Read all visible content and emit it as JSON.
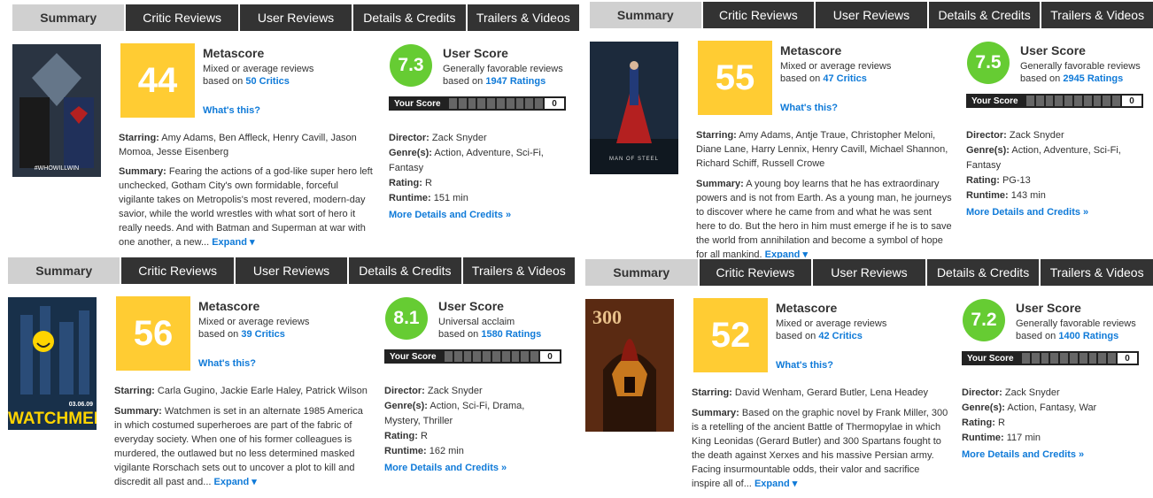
{
  "panels": [
    {
      "tabs": [
        "Summary",
        "Critic Reviews",
        "User Reviews",
        "Details & Credits",
        "Trailers & Videos"
      ],
      "metascore": "44",
      "metascore_title": "Metascore",
      "metascore_desc": "Mixed or average reviews",
      "based_on": "based on",
      "critics_link": "50 Critics",
      "whats_this": "What's this?",
      "userscore": "7.3",
      "userscore_title": "User Score",
      "userscore_desc": "Generally favorable reviews",
      "ratings_link": "1947 Ratings",
      "your_score_label": "Your Score",
      "your_score_value": "0",
      "starring_label": "Starring:",
      "starring": "Amy Adams, Ben Affleck, Henry Cavill, Jason Momoa, Jesse Eisenberg",
      "summary_label": "Summary:",
      "summary": "Fearing the actions of a god-like super hero left unchecked, Gotham City's own formidable, forceful vigilante takes on Metropolis's most revered, modern-day savior, while the world wrestles with what sort of hero it really needs. And with Batman and Superman at war with one another, a new...",
      "expand": "Expand ▾",
      "director_label": "Director:",
      "director": "Zack Snyder",
      "genres_label": "Genre(s):",
      "genres": "Action, Adventure, Sci-Fi, Fantasy",
      "rating_label": "Rating:",
      "rating": "R",
      "runtime_label": "Runtime:",
      "runtime": "151 min",
      "more_details": "More Details and Credits »",
      "poster_text": "#WHOWILLWIN",
      "colors": {
        "bg": "#2a3442",
        "accent": "#7f93a8"
      }
    },
    {
      "tabs": [
        "Summary",
        "Critic Reviews",
        "User Reviews",
        "Details & Credits",
        "Trailers & Videos"
      ],
      "metascore": "55",
      "metascore_title": "Metascore",
      "metascore_desc": "Mixed or average reviews",
      "based_on": "based on",
      "critics_link": "47 Critics",
      "whats_this": "What's this?",
      "userscore": "7.5",
      "userscore_title": "User Score",
      "userscore_desc": "Generally favorable reviews",
      "ratings_link": "2945 Ratings",
      "your_score_label": "Your Score",
      "your_score_value": "0",
      "starring_label": "Starring:",
      "starring": "Amy Adams, Antje Traue, Christopher Meloni, Diane Lane, Harry Lennix, Henry Cavill, Michael Shannon, Richard Schiff, Russell Crowe",
      "summary_label": "Summary:",
      "summary": "A young boy learns that he has extraordinary powers and is not from Earth. As a young man, he journeys to discover where he came from and what he was sent here to do. But the hero in him must emerge if he is to save the world from annihilation and become a symbol of hope for all mankind.",
      "expand": "Expand ▾",
      "director_label": "Director:",
      "director": "Zack Snyder",
      "genres_label": "Genre(s):",
      "genres": "Action, Adventure, Sci-Fi, Fantasy",
      "rating_label": "Rating:",
      "rating": "PG-13",
      "runtime_label": "Runtime:",
      "runtime": "143 min",
      "more_details": "More Details and Credits »",
      "poster_text": "MAN OF STEEL",
      "colors": {
        "bg": "#1c2a3c",
        "accent": "#b42020"
      }
    },
    {
      "tabs": [
        "Summary",
        "Critic Reviews",
        "User Reviews",
        "Details & Credits",
        "Trailers & Videos"
      ],
      "metascore": "56",
      "metascore_title": "Metascore",
      "metascore_desc": "Mixed or average reviews",
      "based_on": "based on",
      "critics_link": "39 Critics",
      "whats_this": "What's this?",
      "userscore": "8.1",
      "userscore_title": "User Score",
      "userscore_desc": "Universal acclaim",
      "ratings_link": "1580 Ratings",
      "your_score_label": "Your Score",
      "your_score_value": "0",
      "starring_label": "Starring:",
      "starring": "Carla Gugino, Jackie Earle Haley, Patrick Wilson",
      "summary_label": "Summary:",
      "summary": "Watchmen is set in an alternate 1985 America in which costumed superheroes are part of the fabric of everyday society. When one of his former colleagues is murdered, the outlawed but no less determined masked vigilante Rorschach sets out to uncover a plot to kill and discredit all past and...",
      "expand": "Expand ▾",
      "director_label": "Director:",
      "director": "Zack Snyder",
      "genres_label": "Genre(s):",
      "genres": "Action, Sci-Fi, Drama, Mystery, Thriller",
      "rating_label": "Rating:",
      "rating": "R",
      "runtime_label": "Runtime:",
      "runtime": "162 min",
      "more_details": "More Details and Credits »",
      "poster_text": "WATCHMEN",
      "poster_date": "03.06.09",
      "colors": {
        "bg": "#18304a",
        "accent": "#ffd400"
      }
    },
    {
      "tabs": [
        "Summary",
        "Critic Reviews",
        "User Reviews",
        "Details & Credits",
        "Trailers & Videos"
      ],
      "metascore": "52",
      "metascore_title": "Metascore",
      "metascore_desc": "Mixed or average reviews",
      "based_on": "based on",
      "critics_link": "42 Critics",
      "whats_this": "What's this?",
      "userscore": "7.2",
      "userscore_title": "User Score",
      "userscore_desc": "Generally favorable reviews",
      "ratings_link": "1400 Ratings",
      "your_score_label": "Your Score",
      "your_score_value": "0",
      "starring_label": "Starring:",
      "starring": "David Wenham, Gerard Butler, Lena Headey",
      "summary_label": "Summary:",
      "summary": "Based on the graphic novel by Frank Miller, 300 is a retelling of the ancient Battle of Thermopylae in which King Leonidas (Gerard Butler) and 300 Spartans fought to the death against Xerxes and his massive Persian army. Facing insurmountable odds, their valor and sacrifice inspire all of...",
      "expand": "Expand ▾",
      "director_label": "Director:",
      "director": "Zack Snyder",
      "genres_label": "Genre(s):",
      "genres": "Action, Fantasy, War",
      "rating_label": "Rating:",
      "rating": "R",
      "runtime_label": "Runtime:",
      "runtime": "117 min",
      "more_details": "More Details and Credits »",
      "poster_text": "300",
      "colors": {
        "bg": "#5a2a12",
        "accent": "#c8781e"
      }
    }
  ]
}
